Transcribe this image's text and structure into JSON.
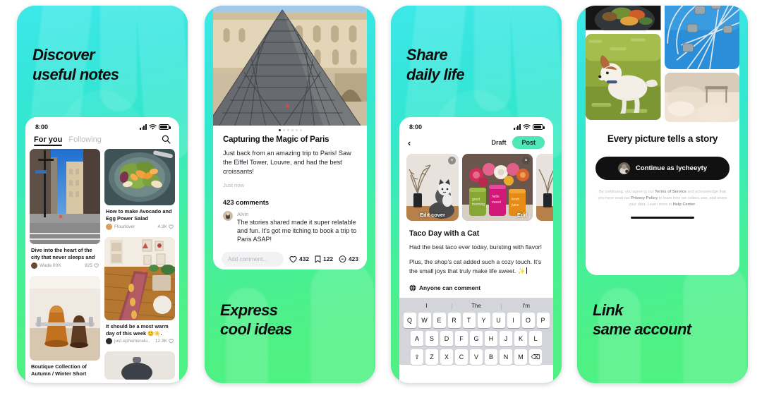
{
  "panels": [
    {
      "id": "discover",
      "headline": "Discover\nuseful notes",
      "headline_position": "top",
      "status": {
        "time": "8:00"
      },
      "tabs": [
        {
          "label": "For you",
          "active": true
        },
        {
          "label": "Following",
          "active": false
        }
      ],
      "search_icon": "search-icon",
      "feed": [
        {
          "caption": "Dive into the heart of the city that never sleeps and",
          "user": "Wade.00X",
          "likes": "925",
          "image": "city-street-photo"
        },
        {
          "caption": "How to make Avocado and Egg Power Salad",
          "user": "Flourlover",
          "likes": "4.3K",
          "image": "avocado-egg-salad-photo"
        },
        {
          "caption": "Boutique Collection of Autumn / Winter Short",
          "user": "",
          "likes": "",
          "image": "leather-boots-photo"
        },
        {
          "caption": "It should be a most warm day of this week 😊☀️.",
          "user": "just.ephemeralu..",
          "likes": "12.3K",
          "image": "cozy-room-photo"
        }
      ]
    },
    {
      "id": "post-detail",
      "headline": "Express\ncool ideas",
      "headline_position": "bottom",
      "hero_image": "louvre-pyramid-photo",
      "carousel_dots": 6,
      "carousel_active": 0,
      "title": "Capturing the Magic of Paris",
      "body": "Just back from an amazing trip to Paris! Saw the Eiffel Tower, Louvre, and had the best croissants!",
      "timestamp": "Just now",
      "comments_count": "423 comments",
      "comment": {
        "author": "Alvin",
        "text": "The stories shared made it super relatable and fun. It's got me itching to book a trip to Paris ASAP!"
      },
      "add_comment_placeholder": "Add comment...",
      "actions": [
        {
          "icon": "heart-icon",
          "count": "432"
        },
        {
          "icon": "bookmark-icon",
          "count": "122"
        },
        {
          "icon": "comment-icon",
          "count": "423"
        }
      ]
    },
    {
      "id": "composer",
      "headline": "Share\ndaily life",
      "headline_position": "top",
      "status": {
        "time": "8:00"
      },
      "nav": {
        "back_icon": "back-chevron-icon",
        "draft_label": "Draft",
        "post_label": "Post"
      },
      "media": [
        {
          "image": "cat-with-branches-photo",
          "label": "Edit cover",
          "close": "×"
        },
        {
          "image": "flowers-and-drinks-photo",
          "label": "Edit",
          "close": "×"
        },
        {
          "image": "branches-photo",
          "label": "",
          "close": ""
        }
      ],
      "title": "Taco Day with a Cat",
      "paragraphs": [
        "Had the best taco ever today, bursting with flavor!",
        "Plus, the shop's cat added such a cozy touch. It's the small joys that truly make life sweet. ✨"
      ],
      "permission": "Anyone can comment",
      "permission_icon": "globe-icon",
      "keyboard": {
        "suggestions": [
          "I",
          "The",
          "I'm"
        ],
        "row1": [
          "Q",
          "W",
          "E",
          "R",
          "T",
          "Y",
          "U",
          "I",
          "O",
          "P"
        ],
        "row2": [
          "A",
          "S",
          "D",
          "F",
          "G",
          "H",
          "J",
          "K",
          "L"
        ],
        "row3": [
          "⇧",
          "Z",
          "X",
          "C",
          "V",
          "B",
          "N",
          "M",
          "⌫"
        ]
      }
    },
    {
      "id": "onboarding",
      "headline": "Link\nsame account",
      "headline_position": "bottom",
      "gallery": [
        "food-bowl-photo",
        "ferris-wheel-photo",
        "jack-russell-dog-photo",
        "beach-photo"
      ],
      "title": "Every picture tells a story",
      "button_label": "Continue as lycheeyty",
      "button_avatar": "user-avatar",
      "legal": {
        "prefix": "By continuing, you agree to our ",
        "tos": "Terms of Service",
        "mid1": " and acknowledge that you have read our ",
        "privacy": "Privacy Policy",
        "mid2": " to learn how we collect, use, and share your data. Learn more in ",
        "help": "Help Center",
        "suffix": "."
      }
    }
  ],
  "colors": {
    "accent_cyan": "#3de8e8",
    "accent_green": "#4ef183",
    "post_button": "#4ee8b6",
    "text_dark": "#111111",
    "muted": "#8b9096"
  }
}
